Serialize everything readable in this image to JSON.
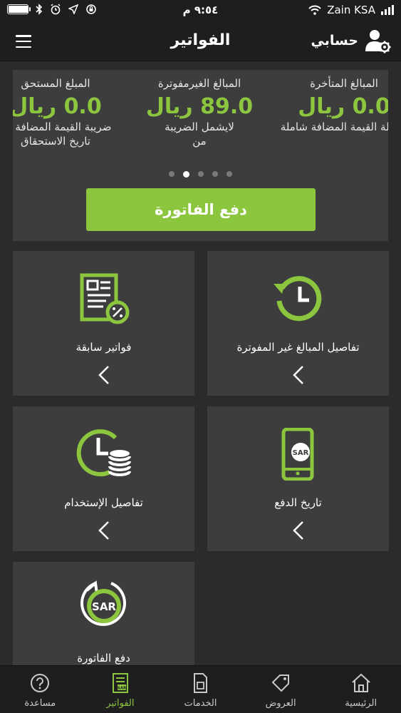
{
  "status_bar": {
    "carrier": "Zain KSA",
    "time": "٩:٥٤ م",
    "battery_level": 0.95
  },
  "header": {
    "title": "الفواتير",
    "account_label": "حسابي"
  },
  "summary": {
    "columns": [
      {
        "title": "المبالغ المتأخرة",
        "amount": "0.0 ريال",
        "lines": [
          "شاملة القيمة المضافة شاملة",
          ""
        ]
      },
      {
        "title": "المبالغ الغيرمفوترة",
        "amount": "89.0 ريال",
        "lines": [
          "لايشمل الضريبة",
          "من"
        ]
      },
      {
        "title": "المبلغ المستحق",
        "amount": "0.0 ريال",
        "lines": [
          "ضريبة القيمة المضافة شا",
          "تاريخ الاستحقاق"
        ]
      }
    ],
    "dots": [
      false,
      true,
      false,
      false,
      false
    ],
    "pay_label": "دفع الفاتورة"
  },
  "tiles": [
    {
      "label": "تفاصيل المبالغ غير المفوترة",
      "icon": "history-clock-icon"
    },
    {
      "label": "فواتير سابقة",
      "icon": "invoice-percent-icon"
    },
    {
      "label": "تاريخ الدفع",
      "icon": "phone-sar-icon"
    },
    {
      "label": "تفاصيل الإستخدام",
      "icon": "clock-coins-icon"
    },
    {
      "label": "دفع الفاتورة",
      "icon": "sar-refresh-icon"
    }
  ],
  "tab_bar": {
    "tabs": [
      {
        "label": "الرئيسية",
        "icon": "home-icon",
        "active": false
      },
      {
        "label": "العروض",
        "icon": "tag-icon",
        "active": false
      },
      {
        "label": "الخدمات",
        "icon": "sim-icon",
        "active": false
      },
      {
        "label": "الفواتير",
        "icon": "bill-icon",
        "active": true
      },
      {
        "label": "مساعدة",
        "icon": "help-icon",
        "active": false
      }
    ]
  },
  "colors": {
    "accent": "#8cc63f",
    "background": "#2b2b2b",
    "card": "#3d3d3d",
    "bar": "#1e1e1e"
  }
}
